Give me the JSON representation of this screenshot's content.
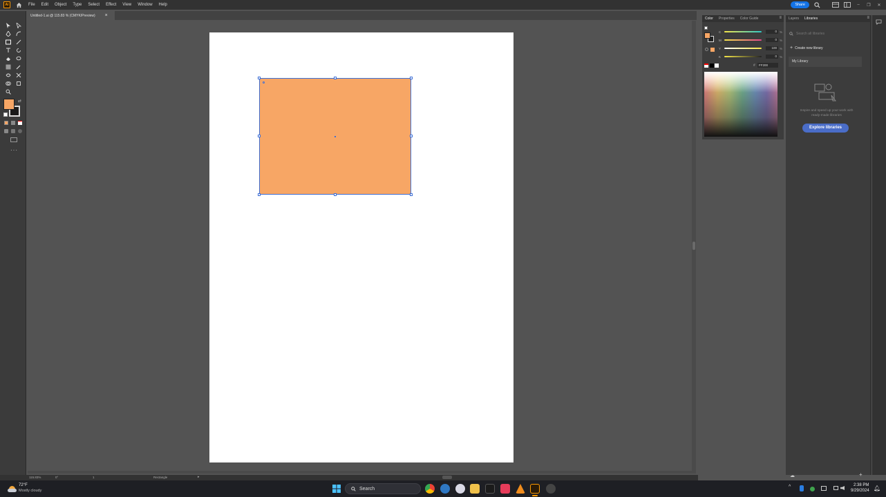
{
  "app": {
    "logo_text": "Ai",
    "menu": [
      "File",
      "Edit",
      "Object",
      "Type",
      "Select",
      "Effect",
      "View",
      "Window",
      "Help"
    ],
    "share_label": "Share"
  },
  "document": {
    "tab_title": "Untitled-1.ai @ 115.83 % (CMYK/Preview)",
    "close_glyph": "×"
  },
  "colors": {
    "fill": "#F7A665",
    "selection": "#3D6FD6",
    "accent": "#1473E6"
  },
  "color_panel": {
    "tabs": [
      "Color",
      "Properties",
      "Color Guide"
    ],
    "channels": [
      {
        "label": "C",
        "value": "0"
      },
      {
        "label": "M",
        "value": "0"
      },
      {
        "label": "Y",
        "value": "100"
      },
      {
        "label": "K",
        "value": "0"
      }
    ],
    "percent": "%",
    "hash": "#",
    "hex": "FF200"
  },
  "libraries": {
    "tabs": [
      "Layers",
      "Libraries"
    ],
    "search_placeholder": "Search all libraries",
    "create_label": "Create new library",
    "library_name": "My Library",
    "empty_text": "Inspire and speed up your work with ready-made libraries",
    "explore_label": "Explore libraries"
  },
  "status": {
    "zoom": "115.83%",
    "rotation": "0°",
    "artboard": "1",
    "tool_name": "Rectangle"
  },
  "taskbar": {
    "temperature": "72°F",
    "weather": "Mostly cloudy",
    "search_label": "Search",
    "time": "2:38 PM",
    "date": "9/29/2024"
  }
}
